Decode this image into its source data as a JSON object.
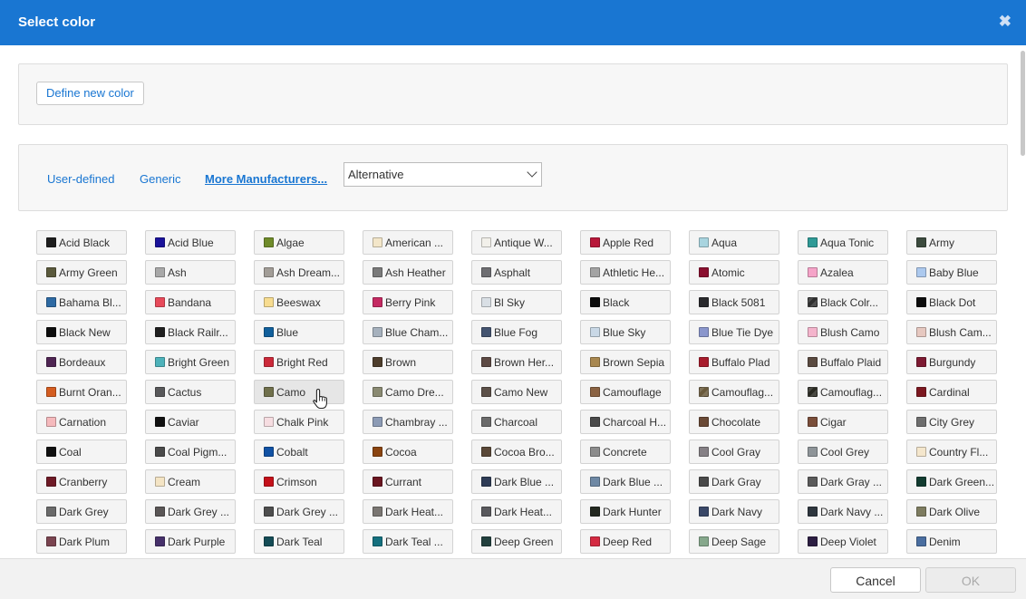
{
  "dialog": {
    "title": "Select color",
    "close_icon": "close-icon"
  },
  "define_button": "Define new color",
  "tabs": [
    {
      "label": "User-defined",
      "active": false
    },
    {
      "label": "Generic",
      "active": false
    },
    {
      "label": "More Manufacturers...",
      "active": true
    }
  ],
  "manufacturer_select": {
    "value": "Alternative"
  },
  "colors": [
    {
      "label": "Acid Black",
      "hex": "#1e1e1e"
    },
    {
      "label": "Acid Blue",
      "hex": "#1a129a"
    },
    {
      "label": "Algae",
      "hex": "#6f8b2a"
    },
    {
      "label": "American ...",
      "hex": "#f3e6c9"
    },
    {
      "label": "Antique W...",
      "hex": "#f2f0ea"
    },
    {
      "label": "Apple Red",
      "hex": "#b8183a"
    },
    {
      "label": "Aqua",
      "hex": "#a8d4df"
    },
    {
      "label": "Aqua Tonic",
      "hex": "#2f9a96"
    },
    {
      "label": "Army",
      "hex": "#3c4b3e"
    },
    {
      "label": "Army Green",
      "hex": "#5b5a3d"
    },
    {
      "label": "Ash",
      "hex": "#a8a8a8"
    },
    {
      "label": "Ash Dream...",
      "hex": "#a29d97"
    },
    {
      "label": "Ash Heather",
      "hex": "#7a7a7a"
    },
    {
      "label": "Asphalt",
      "hex": "#6e6e72"
    },
    {
      "label": "Athletic He...",
      "hex": "#a3a3a3"
    },
    {
      "label": "Atomic",
      "hex": "#8b1030"
    },
    {
      "label": "Azalea",
      "hex": "#f5a3c8"
    },
    {
      "label": "Baby Blue",
      "hex": "#acc9ee"
    },
    {
      "label": "Bahama Bl...",
      "hex": "#2e6aa3"
    },
    {
      "label": "Bandana",
      "hex": "#e74a5a"
    },
    {
      "label": "Beeswax",
      "hex": "#f7dc90"
    },
    {
      "label": "Berry Pink",
      "hex": "#c42a62"
    },
    {
      "label": "Bl Sky",
      "hex": "#d9dfe5"
    },
    {
      "label": "Black",
      "hex": "#0d0d0d"
    },
    {
      "label": "Black 5081",
      "hex": "#2a2a2d"
    },
    {
      "label": "Black Colr...",
      "hex": "#2f2f2f",
      "pattern": true
    },
    {
      "label": "Black Dot",
      "hex": "#0d0d0d"
    },
    {
      "label": "Black New",
      "hex": "#0d0d0d"
    },
    {
      "label": "Black Railr...",
      "hex": "#1f1f1f"
    },
    {
      "label": "Blue",
      "hex": "#12609c"
    },
    {
      "label": "Blue Cham...",
      "hex": "#a6b1bd"
    },
    {
      "label": "Blue Fog",
      "hex": "#445470"
    },
    {
      "label": "Blue Sky",
      "hex": "#c9d8e6"
    },
    {
      "label": "Blue Tie Dye",
      "hex": "#8a96cc"
    },
    {
      "label": "Blush Camo",
      "hex": "#f4b4cc"
    },
    {
      "label": "Blush Cam...",
      "hex": "#e6c8c0"
    },
    {
      "label": "Bordeaux",
      "hex": "#4f2553"
    },
    {
      "label": "Bright Green",
      "hex": "#4db2ba"
    },
    {
      "label": "Bright Red",
      "hex": "#cc2a3a"
    },
    {
      "label": "Brown",
      "hex": "#4e3e2c"
    },
    {
      "label": "Brown Her...",
      "hex": "#5d4a44"
    },
    {
      "label": "Brown Sepia",
      "hex": "#a8874f"
    },
    {
      "label": "Buffalo Plad",
      "hex": "#a71c2c"
    },
    {
      "label": "Buffalo Plaid",
      "hex": "#5a4a40"
    },
    {
      "label": "Burgundy",
      "hex": "#7d1a32"
    },
    {
      "label": "Burnt Oran...",
      "hex": "#d45d21"
    },
    {
      "label": "Cactus",
      "hex": "#58585a"
    },
    {
      "label": "Camo",
      "hex": "#6f6f4b"
    },
    {
      "label": "Camo Dre...",
      "hex": "#8a8a72"
    },
    {
      "label": "Camo New",
      "hex": "#5c5048"
    },
    {
      "label": "Camouflage",
      "hex": "#8a6242"
    },
    {
      "label": "Camouflag...",
      "hex": "#6a5a3c",
      "pattern": true
    },
    {
      "label": "Camouflag...",
      "hex": "#2a2a22",
      "pattern": true
    },
    {
      "label": "Cardinal",
      "hex": "#7c1820"
    },
    {
      "label": "Carnation",
      "hex": "#f5b9bc"
    },
    {
      "label": "Caviar",
      "hex": "#111111"
    },
    {
      "label": "Chalk Pink",
      "hex": "#f6dde1"
    },
    {
      "label": "Chambray ...",
      "hex": "#8c9bb5"
    },
    {
      "label": "Charcoal",
      "hex": "#6a6a6a"
    },
    {
      "label": "Charcoal H...",
      "hex": "#4a4a4a"
    },
    {
      "label": "Chocolate",
      "hex": "#6a4a36"
    },
    {
      "label": "Cigar",
      "hex": "#7a4e3a"
    },
    {
      "label": "City Grey",
      "hex": "#6e6e6e"
    },
    {
      "label": "Coal",
      "hex": "#101010"
    },
    {
      "label": "Coal Pigm...",
      "hex": "#4a4a4a"
    },
    {
      "label": "Cobalt",
      "hex": "#1152a4"
    },
    {
      "label": "Cocoa",
      "hex": "#8a4410"
    },
    {
      "label": "Cocoa Bro...",
      "hex": "#5a4838"
    },
    {
      "label": "Concrete",
      "hex": "#8c8c8c"
    },
    {
      "label": "Cool Gray",
      "hex": "#858085"
    },
    {
      "label": "Cool Grey",
      "hex": "#8e9498"
    },
    {
      "label": "Country Fl...",
      "hex": "#f4e6cc"
    },
    {
      "label": "Cranberry",
      "hex": "#6e1a26"
    },
    {
      "label": "Cream",
      "hex": "#f4e4c4"
    },
    {
      "label": "Crimson",
      "hex": "#c4111a"
    },
    {
      "label": "Currant",
      "hex": "#6a1620"
    },
    {
      "label": "Dark Blue ...",
      "hex": "#2e3c56"
    },
    {
      "label": "Dark Blue ...",
      "hex": "#6e88a4"
    },
    {
      "label": "Dark Gray",
      "hex": "#4a4a4a"
    },
    {
      "label": "Dark Gray ...",
      "hex": "#5a5a5a"
    },
    {
      "label": "Dark Green...",
      "hex": "#123c30"
    },
    {
      "label": "Dark Grey",
      "hex": "#6a6a6a"
    },
    {
      "label": "Dark Grey ...",
      "hex": "#5a5656"
    },
    {
      "label": "Dark Grey ...",
      "hex": "#4e4e4e"
    },
    {
      "label": "Dark Heat...",
      "hex": "#7a7672"
    },
    {
      "label": "Dark Heat...",
      "hex": "#5a5a5e"
    },
    {
      "label": "Dark Hunter",
      "hex": "#232820"
    },
    {
      "label": "Dark Navy",
      "hex": "#3a4868"
    },
    {
      "label": "Dark Navy ...",
      "hex": "#2e363e"
    },
    {
      "label": "Dark Olive",
      "hex": "#7e7c60"
    },
    {
      "label": "Dark Plum",
      "hex": "#7a4450"
    },
    {
      "label": "Dark Purple",
      "hex": "#46306a"
    },
    {
      "label": "Dark Teal",
      "hex": "#154c56"
    },
    {
      "label": "Dark Teal ...",
      "hex": "#15707e"
    },
    {
      "label": "Deep Green",
      "hex": "#22403e"
    },
    {
      "label": "Deep Red",
      "hex": "#d42a42"
    },
    {
      "label": "Deep Sage",
      "hex": "#86a88c"
    },
    {
      "label": "Deep Violet",
      "hex": "#2c1e42"
    },
    {
      "label": "Denim",
      "hex": "#4a6ea0"
    }
  ],
  "footer": {
    "cancel": "Cancel",
    "ok": "OK"
  }
}
